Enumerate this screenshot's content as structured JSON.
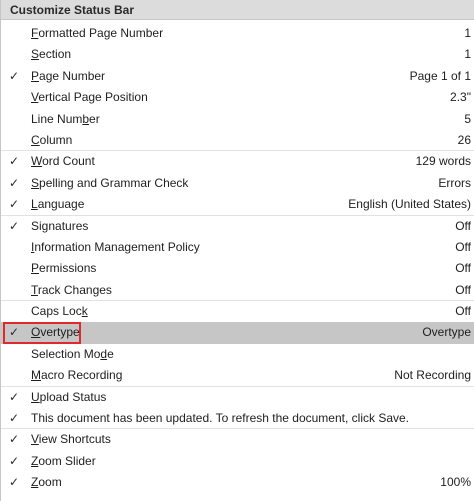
{
  "menu": {
    "title": "Customize Status Bar",
    "check_glyph": "✓",
    "items": [
      {
        "pre": "",
        "ul": "F",
        "post": "ormatted Page Number",
        "value": "1",
        "checked": false
      },
      {
        "pre": "",
        "ul": "S",
        "post": "ection",
        "value": "1",
        "checked": false
      },
      {
        "pre": "",
        "ul": "P",
        "post": "age Number",
        "value": "Page 1 of 1",
        "checked": true
      },
      {
        "pre": "",
        "ul": "V",
        "post": "ertical Page Position",
        "value": "2.3\"",
        "checked": false
      },
      {
        "pre": "Line Num",
        "ul": "b",
        "post": "er",
        "value": "5",
        "checked": false
      },
      {
        "pre": "",
        "ul": "C",
        "post": "olumn",
        "value": "26",
        "checked": false
      },
      {
        "pre": "",
        "ul": "W",
        "post": "ord Count",
        "value": "129 words",
        "checked": true
      },
      {
        "pre": "",
        "ul": "S",
        "post": "pelling and Grammar Check",
        "value": "Errors",
        "checked": true
      },
      {
        "pre": "",
        "ul": "L",
        "post": "anguage",
        "value": "English (United States)",
        "checked": true
      },
      {
        "pre": "Si",
        "ul": "g",
        "post": "natures",
        "value": "Off",
        "checked": true
      },
      {
        "pre": "",
        "ul": "I",
        "post": "nformation Management Policy",
        "value": "Off",
        "checked": false
      },
      {
        "pre": "",
        "ul": "P",
        "post": "ermissions",
        "value": "Off",
        "checked": false
      },
      {
        "pre": "",
        "ul": "T",
        "post": "rack Changes",
        "value": "Off",
        "checked": false
      },
      {
        "pre": "Caps Loc",
        "ul": "k",
        "post": "",
        "value": "Off",
        "checked": false
      },
      {
        "pre": "",
        "ul": "O",
        "post": "vertype",
        "value": "Overtype",
        "checked": true
      },
      {
        "pre": "Selection Mo",
        "ul": "d",
        "post": "e",
        "value": "",
        "checked": false
      },
      {
        "pre": "",
        "ul": "M",
        "post": "acro Recording",
        "value": "Not Recording",
        "checked": false
      },
      {
        "pre": "",
        "ul": "U",
        "post": "pload Status",
        "value": "",
        "checked": true
      },
      {
        "pre": "This document has been updated. To refresh the document, click Save.",
        "ul": "",
        "post": "",
        "value": "",
        "checked": true
      },
      {
        "pre": "",
        "ul": "V",
        "post": "iew Shortcuts",
        "value": "",
        "checked": true
      },
      {
        "pre": "",
        "ul": "Z",
        "post": "oom Slider",
        "value": "",
        "checked": true
      },
      {
        "pre": "",
        "ul": "Z",
        "post": "oom",
        "value": "100%",
        "checked": true
      }
    ]
  }
}
